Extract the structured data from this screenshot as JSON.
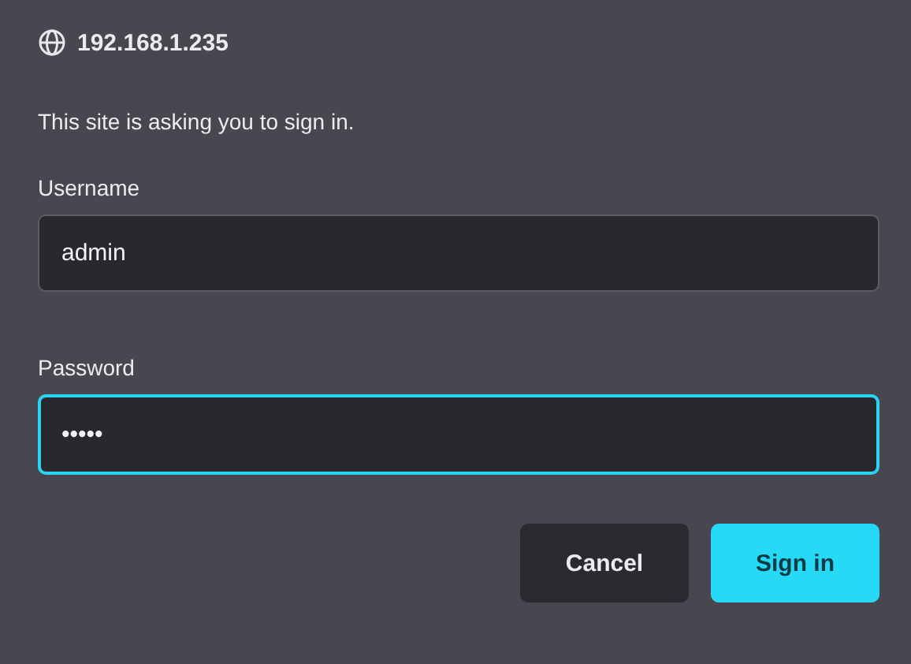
{
  "dialog": {
    "host": "192.168.1.235",
    "message": "This site is asking you to sign in."
  },
  "fields": [
    {
      "label": "Username",
      "value": "admin",
      "focused": false
    },
    {
      "label": "Password",
      "value": "•••••",
      "focused": true
    }
  ],
  "buttons": [
    {
      "label": "Cancel",
      "kind": "secondary"
    },
    {
      "label": "Sign in",
      "kind": "primary"
    }
  ]
}
